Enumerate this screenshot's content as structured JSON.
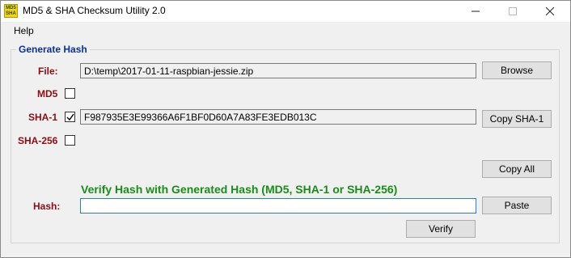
{
  "window": {
    "title": "MD5 & SHA Checksum Utility 2.0",
    "icon_text_top": "MD5",
    "icon_text_bottom": "SHA"
  },
  "menu": {
    "items": [
      "Help"
    ]
  },
  "generate": {
    "group_label": "Generate Hash",
    "file_label": "File:",
    "file_value": "D:\\temp\\2017-01-11-raspbian-jessie.zip",
    "browse_label": "Browse",
    "md5_label": "MD5",
    "md5_checked": false,
    "md5_value": "",
    "sha1_label": "SHA-1",
    "sha1_checked": true,
    "sha1_value": "F987935E3E99366A6F1BF0D60A7A83FE3EDB013C",
    "copy_sha1_label": "Copy SHA-1",
    "sha256_label": "SHA-256",
    "sha256_checked": false,
    "sha256_value": "",
    "copy_all_label": "Copy All"
  },
  "verify": {
    "heading": "Verify Hash with Generated Hash (MD5, SHA-1 or SHA-256)",
    "hash_label": "Hash:",
    "hash_value": "",
    "paste_label": "Paste",
    "verify_label": "Verify"
  },
  "colors": {
    "label_red": "#8b0d14",
    "group_blue": "#0b2fa1",
    "verify_green": "#1b8c1b",
    "focus_blue": "#2c7bd6"
  }
}
